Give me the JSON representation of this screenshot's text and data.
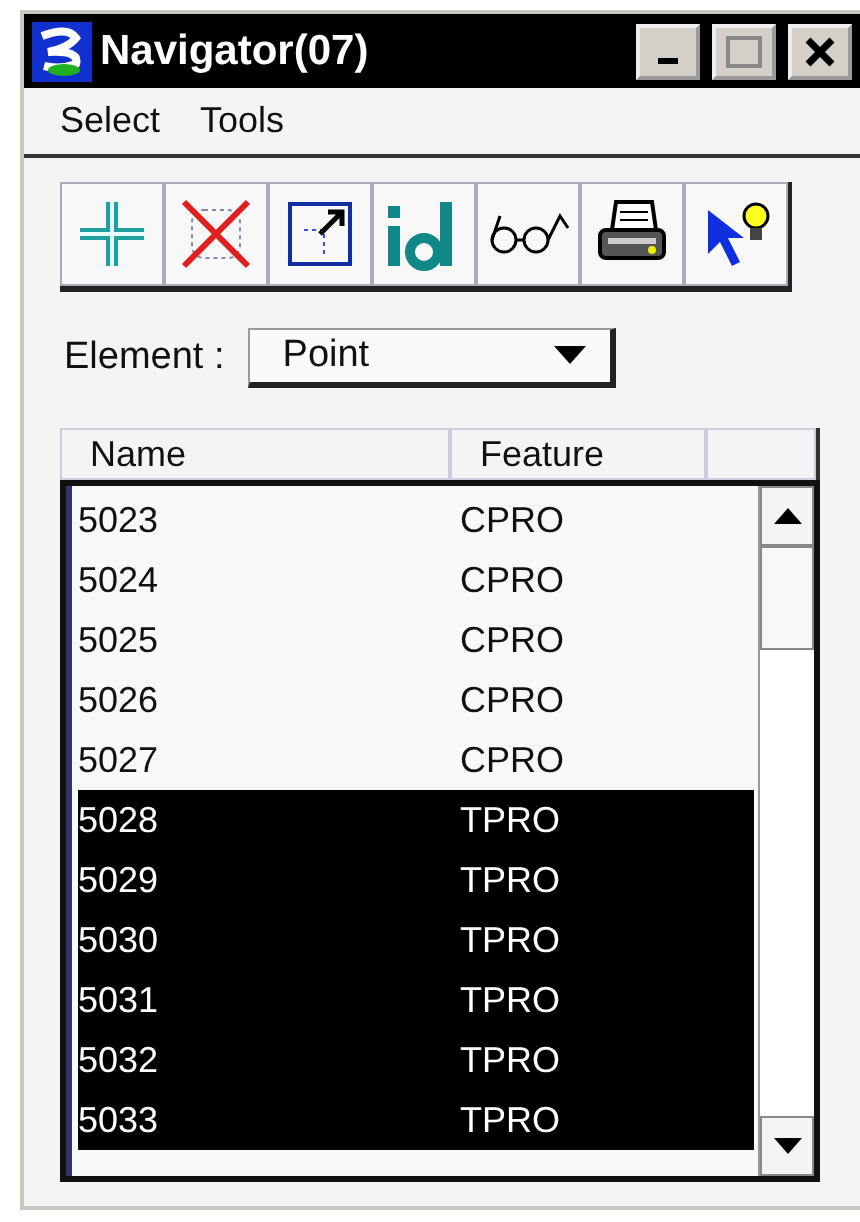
{
  "window": {
    "title": "Navigator(07)"
  },
  "menu": [
    "Select",
    "Tools"
  ],
  "element": {
    "label": "Element :",
    "value": "Point"
  },
  "table": {
    "columns": [
      "Name",
      "Feature"
    ],
    "rows": [
      {
        "name": "5023",
        "feature": "CPRO",
        "selected": false
      },
      {
        "name": "5024",
        "feature": "CPRO",
        "selected": false
      },
      {
        "name": "5025",
        "feature": "CPRO",
        "selected": false
      },
      {
        "name": "5026",
        "feature": "CPRO",
        "selected": false
      },
      {
        "name": "5027",
        "feature": "CPRO",
        "selected": false
      },
      {
        "name": "5028",
        "feature": "TPRO",
        "selected": true
      },
      {
        "name": "5029",
        "feature": "TPRO",
        "selected": true
      },
      {
        "name": "5030",
        "feature": "TPRO",
        "selected": true
      },
      {
        "name": "5031",
        "feature": "TPRO",
        "selected": true
      },
      {
        "name": "5032",
        "feature": "TPRO",
        "selected": true
      },
      {
        "name": "5033",
        "feature": "TPRO",
        "selected": true
      }
    ]
  }
}
